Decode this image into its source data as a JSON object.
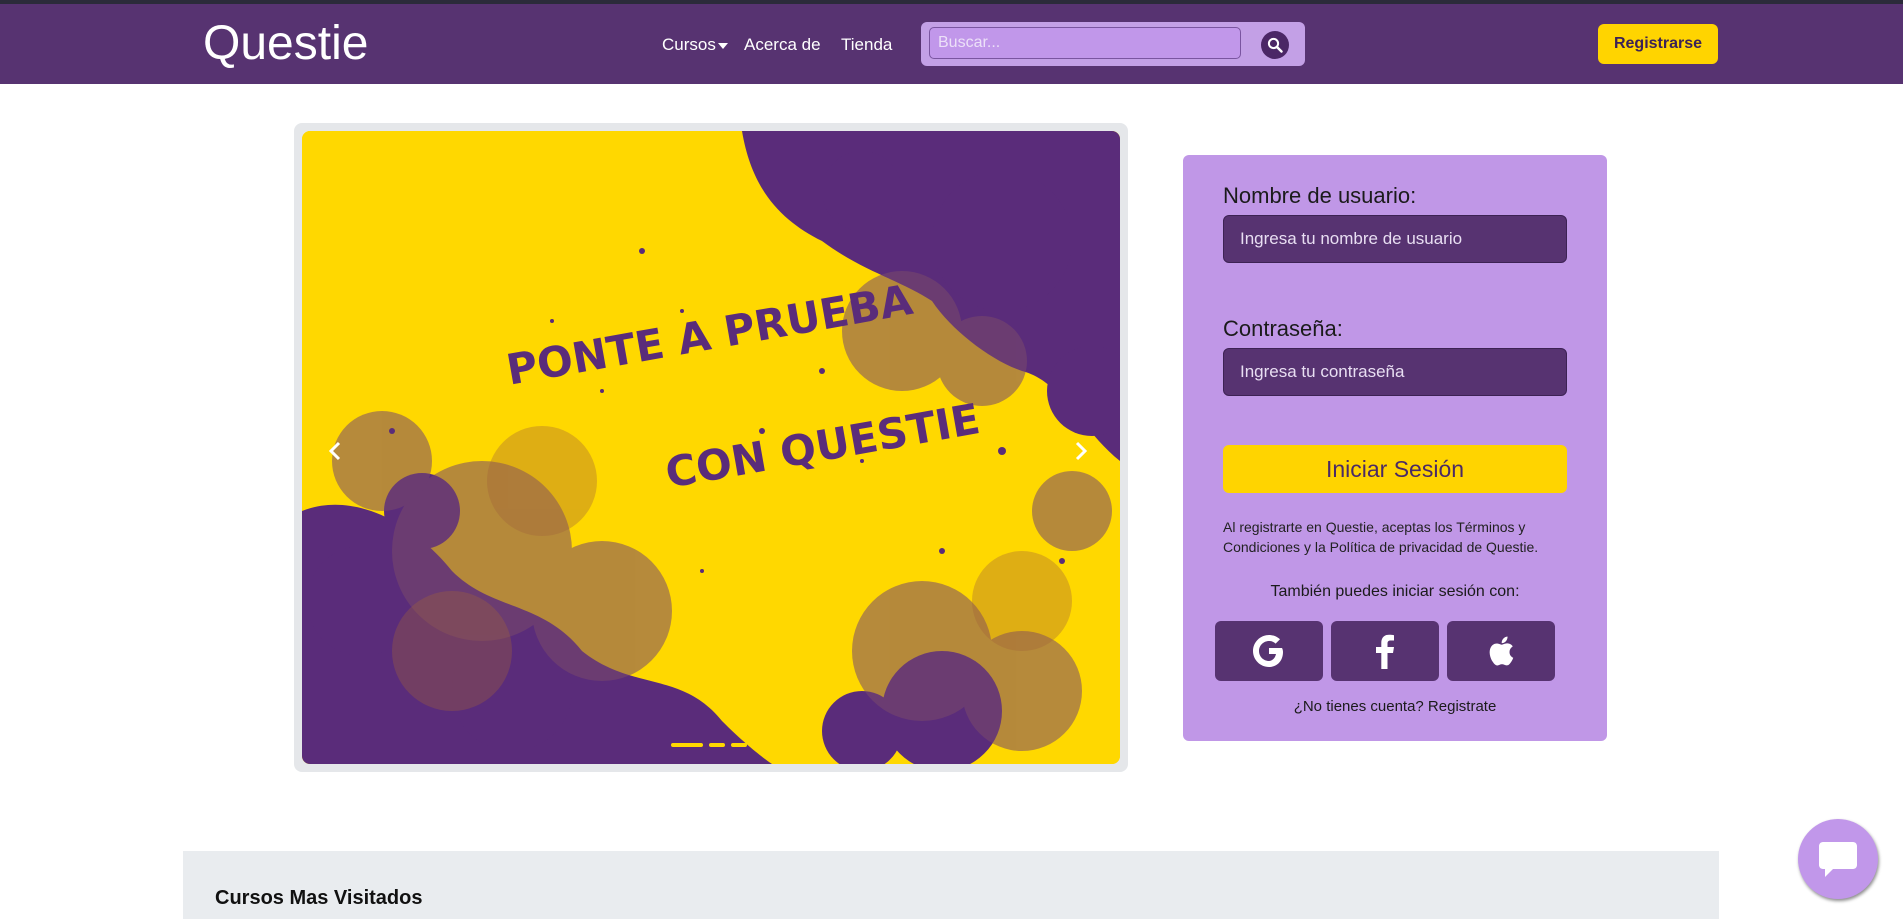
{
  "header": {
    "brand": "Questie",
    "nav": {
      "courses": "Cursos",
      "about": "Acerca de",
      "store": "Tienda"
    },
    "search": {
      "placeholder": "Buscar...",
      "value": ""
    },
    "register_label": "Registrarse"
  },
  "carousel": {
    "slide_text": [
      "PONTE A PRUEBA",
      "CON QUESTIE"
    ],
    "slides_count": 3,
    "active_slide": 1,
    "colors": {
      "background": "#ffd800",
      "splash": "#5a2c7a"
    }
  },
  "login": {
    "username_label": "Nombre de usuario:",
    "username_placeholder": "Ingresa tu nombre de usuario",
    "password_label": "Contraseña:",
    "password_placeholder": "Ingresa tu contraseña",
    "submit_label": "Iniciar Sesión",
    "terms": "Al registrarte en Questie, aceptas los Términos y Condiciones y la Política de privacidad de Questie.",
    "alt_login": "También puedes iniciar sesión con:",
    "providers": [
      "google-icon",
      "facebook-icon",
      "apple-icon"
    ],
    "signup_prompt": "¿No tienes cuenta? Registrate"
  },
  "sections": {
    "most_visited_title": "Cursos Mas Visitados"
  },
  "colors": {
    "primary": "#573371",
    "accent": "#ffd400",
    "card": "#c097e7"
  }
}
